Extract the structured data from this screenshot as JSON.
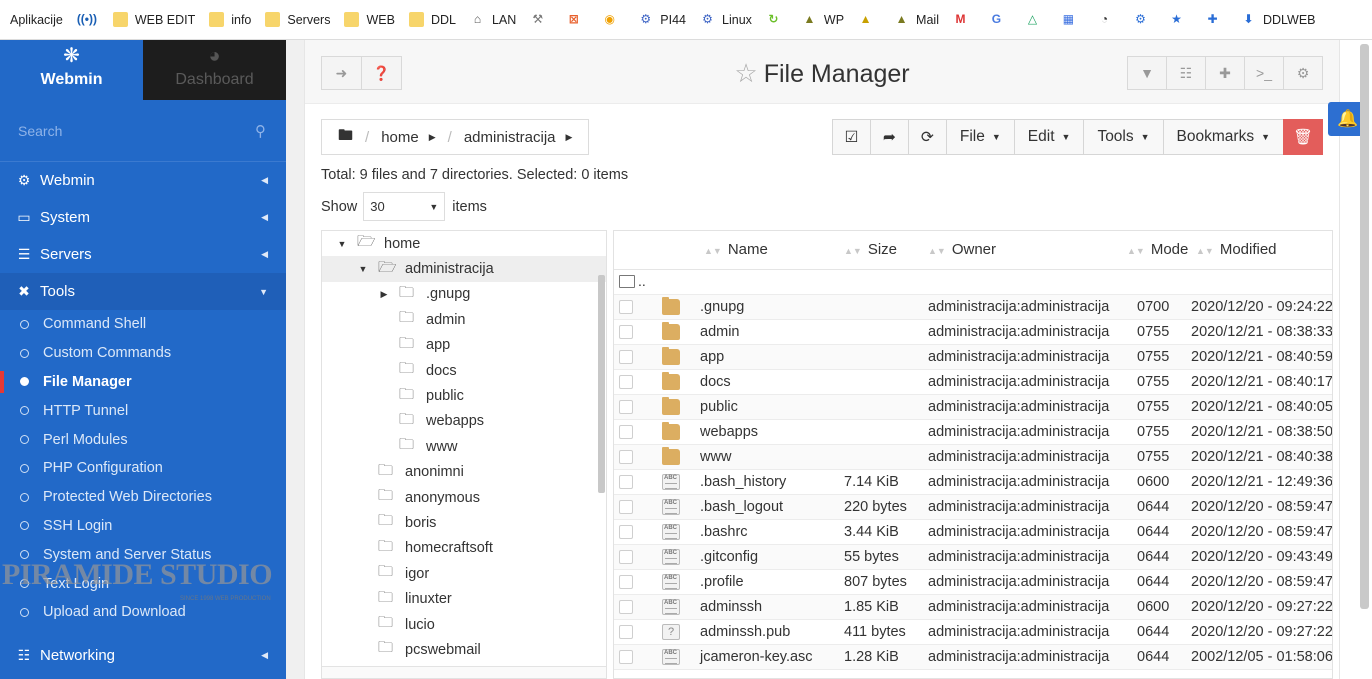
{
  "bookmarks": [
    {
      "label": "Aplikacije",
      "icon": "apps-grid-icon"
    },
    {
      "label": "",
      "icon": "radio-icon"
    },
    {
      "label": "WEB EDIT",
      "icon": "folder-icon"
    },
    {
      "label": "info",
      "icon": "folder-icon"
    },
    {
      "label": "Servers",
      "icon": "folder-icon"
    },
    {
      "label": "WEB",
      "icon": "folder-icon"
    },
    {
      "label": "DDL",
      "icon": "folder-icon"
    },
    {
      "label": "LAN",
      "icon": "lan-icon"
    },
    {
      "label": "",
      "icon": "tools-icon"
    },
    {
      "label": "",
      "icon": "x-app-icon"
    },
    {
      "label": "",
      "icon": "circle-app-icon"
    },
    {
      "label": "PI44",
      "icon": "network-icon"
    },
    {
      "label": "Linux",
      "icon": "network-icon"
    },
    {
      "label": "",
      "icon": "refresh-app-icon"
    },
    {
      "label": "WP",
      "icon": "wp-icon"
    },
    {
      "label": "",
      "icon": "pma-icon"
    },
    {
      "label": "Mail",
      "icon": "mail-icon"
    },
    {
      "label": "",
      "icon": "gmail-icon"
    },
    {
      "label": "",
      "icon": "translate-icon"
    },
    {
      "label": "",
      "icon": "drive-icon"
    },
    {
      "label": "",
      "icon": "calendar-icon"
    },
    {
      "label": "",
      "icon": "speed-icon"
    },
    {
      "label": "",
      "icon": "gear-icon"
    },
    {
      "label": "",
      "icon": "star-icon"
    },
    {
      "label": "",
      "icon": "puzzle-icon"
    },
    {
      "label": "DDLWEB",
      "icon": "download-icon"
    }
  ],
  "sidebar": {
    "brand": "Webmin",
    "dashboard": "Dashboard",
    "search_placeholder": "Search",
    "nav": [
      {
        "label": "Webmin",
        "icon": "gear-icon"
      },
      {
        "label": "System",
        "icon": "monitor-icon"
      },
      {
        "label": "Servers",
        "icon": "servers-icon"
      },
      {
        "label": "Tools",
        "icon": "wrench-icon"
      }
    ],
    "tools": [
      "Command Shell",
      "Custom Commands",
      "File Manager",
      "HTTP Tunnel",
      "Perl Modules",
      "PHP Configuration",
      "Protected Web Directories",
      "SSH Login",
      "System and Server Status",
      "Text Login",
      "Upload and Download"
    ],
    "networking": "Networking",
    "watermark": "PIRAMIDE STUDIO",
    "watermark_sub": "SINCE 1998 WEB PRODUCTION"
  },
  "header": {
    "title": "File Manager"
  },
  "breadcrumb": {
    "root": "home",
    "current": "administracija"
  },
  "toolbar": {
    "file": "File",
    "edit": "Edit",
    "tools": "Tools",
    "bookmarks": "Bookmarks"
  },
  "summary": "Total: 9 files and 7 directories. Selected: 0 items",
  "show": {
    "label": "Show",
    "value": "30",
    "suffix": "items"
  },
  "tree": {
    "root": "home",
    "current": "administracija",
    "children": [
      ".gnupg",
      "admin",
      "app",
      "docs",
      "public",
      "webapps",
      "www"
    ],
    "siblings": [
      "anonimni",
      "anonymous",
      "boris",
      "homecraftsoft",
      "igor",
      "linuxter",
      "lucio",
      "pcswebmail"
    ]
  },
  "columns": {
    "name": "Name",
    "size": "Size",
    "owner": "Owner",
    "mode": "Mode",
    "modified": "Modified"
  },
  "up": "..",
  "files": [
    {
      "type": "folder",
      "name": ".gnupg",
      "size": "",
      "owner": "administracija:administracija",
      "mode": "0700",
      "modified": "2020/12/20 - 09:24:22"
    },
    {
      "type": "folder",
      "name": "admin",
      "size": "",
      "owner": "administracija:administracija",
      "mode": "0755",
      "modified": "2020/12/21 - 08:38:33"
    },
    {
      "type": "folder",
      "name": "app",
      "size": "",
      "owner": "administracija:administracija",
      "mode": "0755",
      "modified": "2020/12/21 - 08:40:59"
    },
    {
      "type": "folder",
      "name": "docs",
      "size": "",
      "owner": "administracija:administracija",
      "mode": "0755",
      "modified": "2020/12/21 - 08:40:17"
    },
    {
      "type": "folder",
      "name": "public",
      "size": "",
      "owner": "administracija:administracija",
      "mode": "0755",
      "modified": "2020/12/21 - 08:40:05"
    },
    {
      "type": "folder",
      "name": "webapps",
      "size": "",
      "owner": "administracija:administracija",
      "mode": "0755",
      "modified": "2020/12/21 - 08:38:50"
    },
    {
      "type": "folder",
      "name": "www",
      "size": "",
      "owner": "administracija:administracija",
      "mode": "0755",
      "modified": "2020/12/21 - 08:40:38"
    },
    {
      "type": "text",
      "name": ".bash_history",
      "size": "7.14 KiB",
      "owner": "administracija:administracija",
      "mode": "0600",
      "modified": "2020/12/21 - 12:49:36"
    },
    {
      "type": "text",
      "name": ".bash_logout",
      "size": "220 bytes",
      "owner": "administracija:administracija",
      "mode": "0644",
      "modified": "2020/12/20 - 08:59:47"
    },
    {
      "type": "text",
      "name": ".bashrc",
      "size": "3.44 KiB",
      "owner": "administracija:administracija",
      "mode": "0644",
      "modified": "2020/12/20 - 08:59:47"
    },
    {
      "type": "text",
      "name": ".gitconfig",
      "size": "55 bytes",
      "owner": "administracija:administracija",
      "mode": "0644",
      "modified": "2020/12/20 - 09:43:49"
    },
    {
      "type": "text",
      "name": ".profile",
      "size": "807 bytes",
      "owner": "administracija:administracija",
      "mode": "0644",
      "modified": "2020/12/20 - 08:59:47"
    },
    {
      "type": "text",
      "name": "adminssh",
      "size": "1.85 KiB",
      "owner": "administracija:administracija",
      "mode": "0600",
      "modified": "2020/12/20 - 09:27:22"
    },
    {
      "type": "unknown",
      "name": "adminssh.pub",
      "size": "411 bytes",
      "owner": "administracija:administracija",
      "mode": "0644",
      "modified": "2020/12/20 - 09:27:22"
    },
    {
      "type": "text",
      "name": "jcameron-key.asc",
      "size": "1.28 KiB",
      "owner": "administracija:administracija",
      "mode": "0644",
      "modified": "2002/12/05 - 01:58:06"
    }
  ]
}
